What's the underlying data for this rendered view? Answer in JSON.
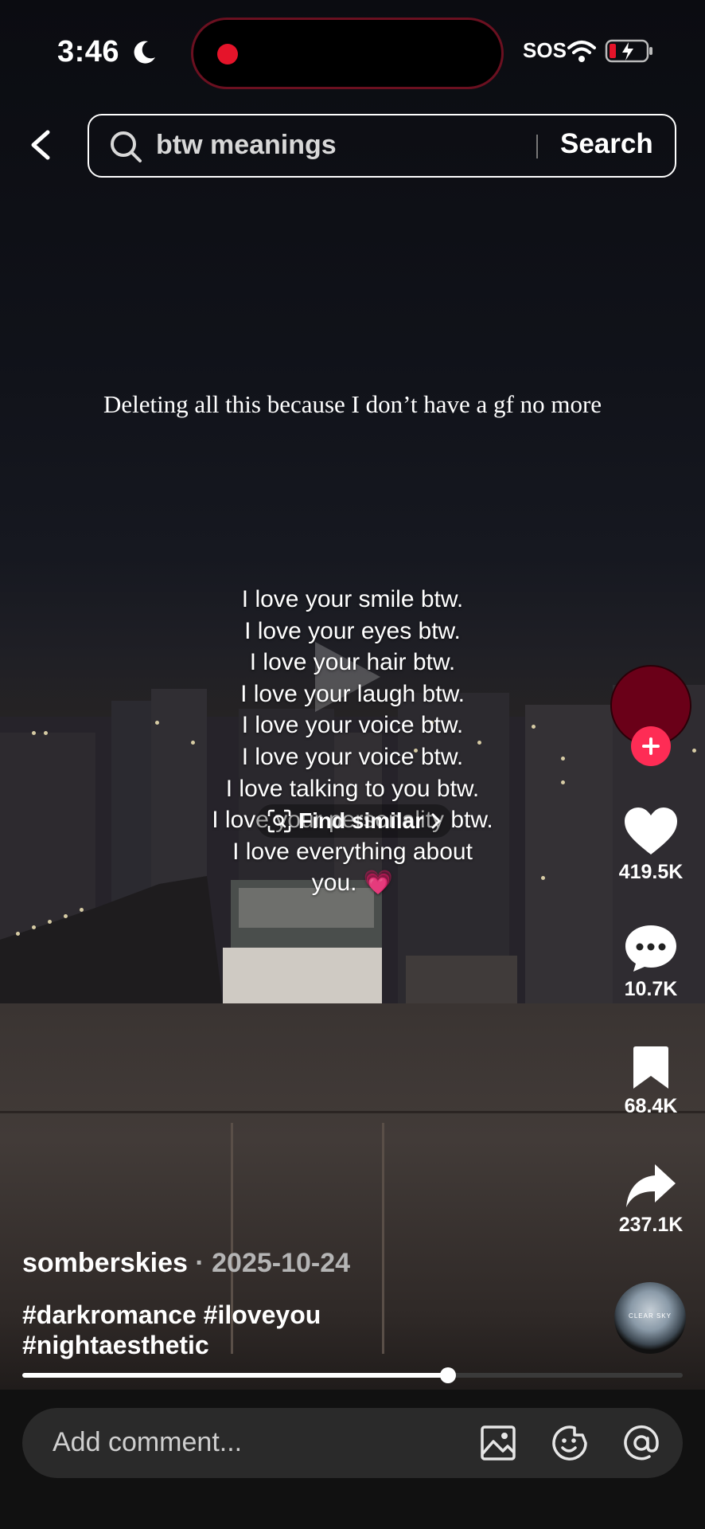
{
  "status_bar": {
    "time": "3:46",
    "sos": "SOS",
    "icons": [
      "moon-icon",
      "wifi-icon",
      "battery-charging-icon"
    ],
    "recording_indicator_color": "#e5142a"
  },
  "search": {
    "query": "btw meanings",
    "button_label": "Search"
  },
  "video": {
    "caption_top": "Deleting all this because I don’t have a gf no more",
    "lyrics": [
      "I love your smile btw.",
      "I love your eyes btw.",
      "I love your hair btw.",
      "I love your laugh btw.",
      "I love your voice btw.",
      "I love your voice btw.",
      "I love talking to you btw.",
      "I love your personality btw.",
      "I love everything about",
      "you."
    ],
    "lyrics_emoji": "💗",
    "find_similar_label": "Find similar"
  },
  "actions": {
    "likes": "419.5K",
    "comments": "10.7K",
    "saves": "68.4K",
    "shares": "237.1K",
    "avatar_color": "#6a0018",
    "follow_color": "#fe2c55",
    "music_disc_text": "CLEAR SKY"
  },
  "post": {
    "author": "somberskies",
    "date": "2025-10-24",
    "separator": " · ",
    "hashtags_line1": "#darkromance #iloveyou",
    "hashtags_line2": "#nightaesthetic",
    "progress_fraction": 0.645
  },
  "comment_bar": {
    "placeholder": "Add comment...",
    "icons": [
      "image-icon",
      "emoji-icon",
      "mention-icon"
    ]
  }
}
